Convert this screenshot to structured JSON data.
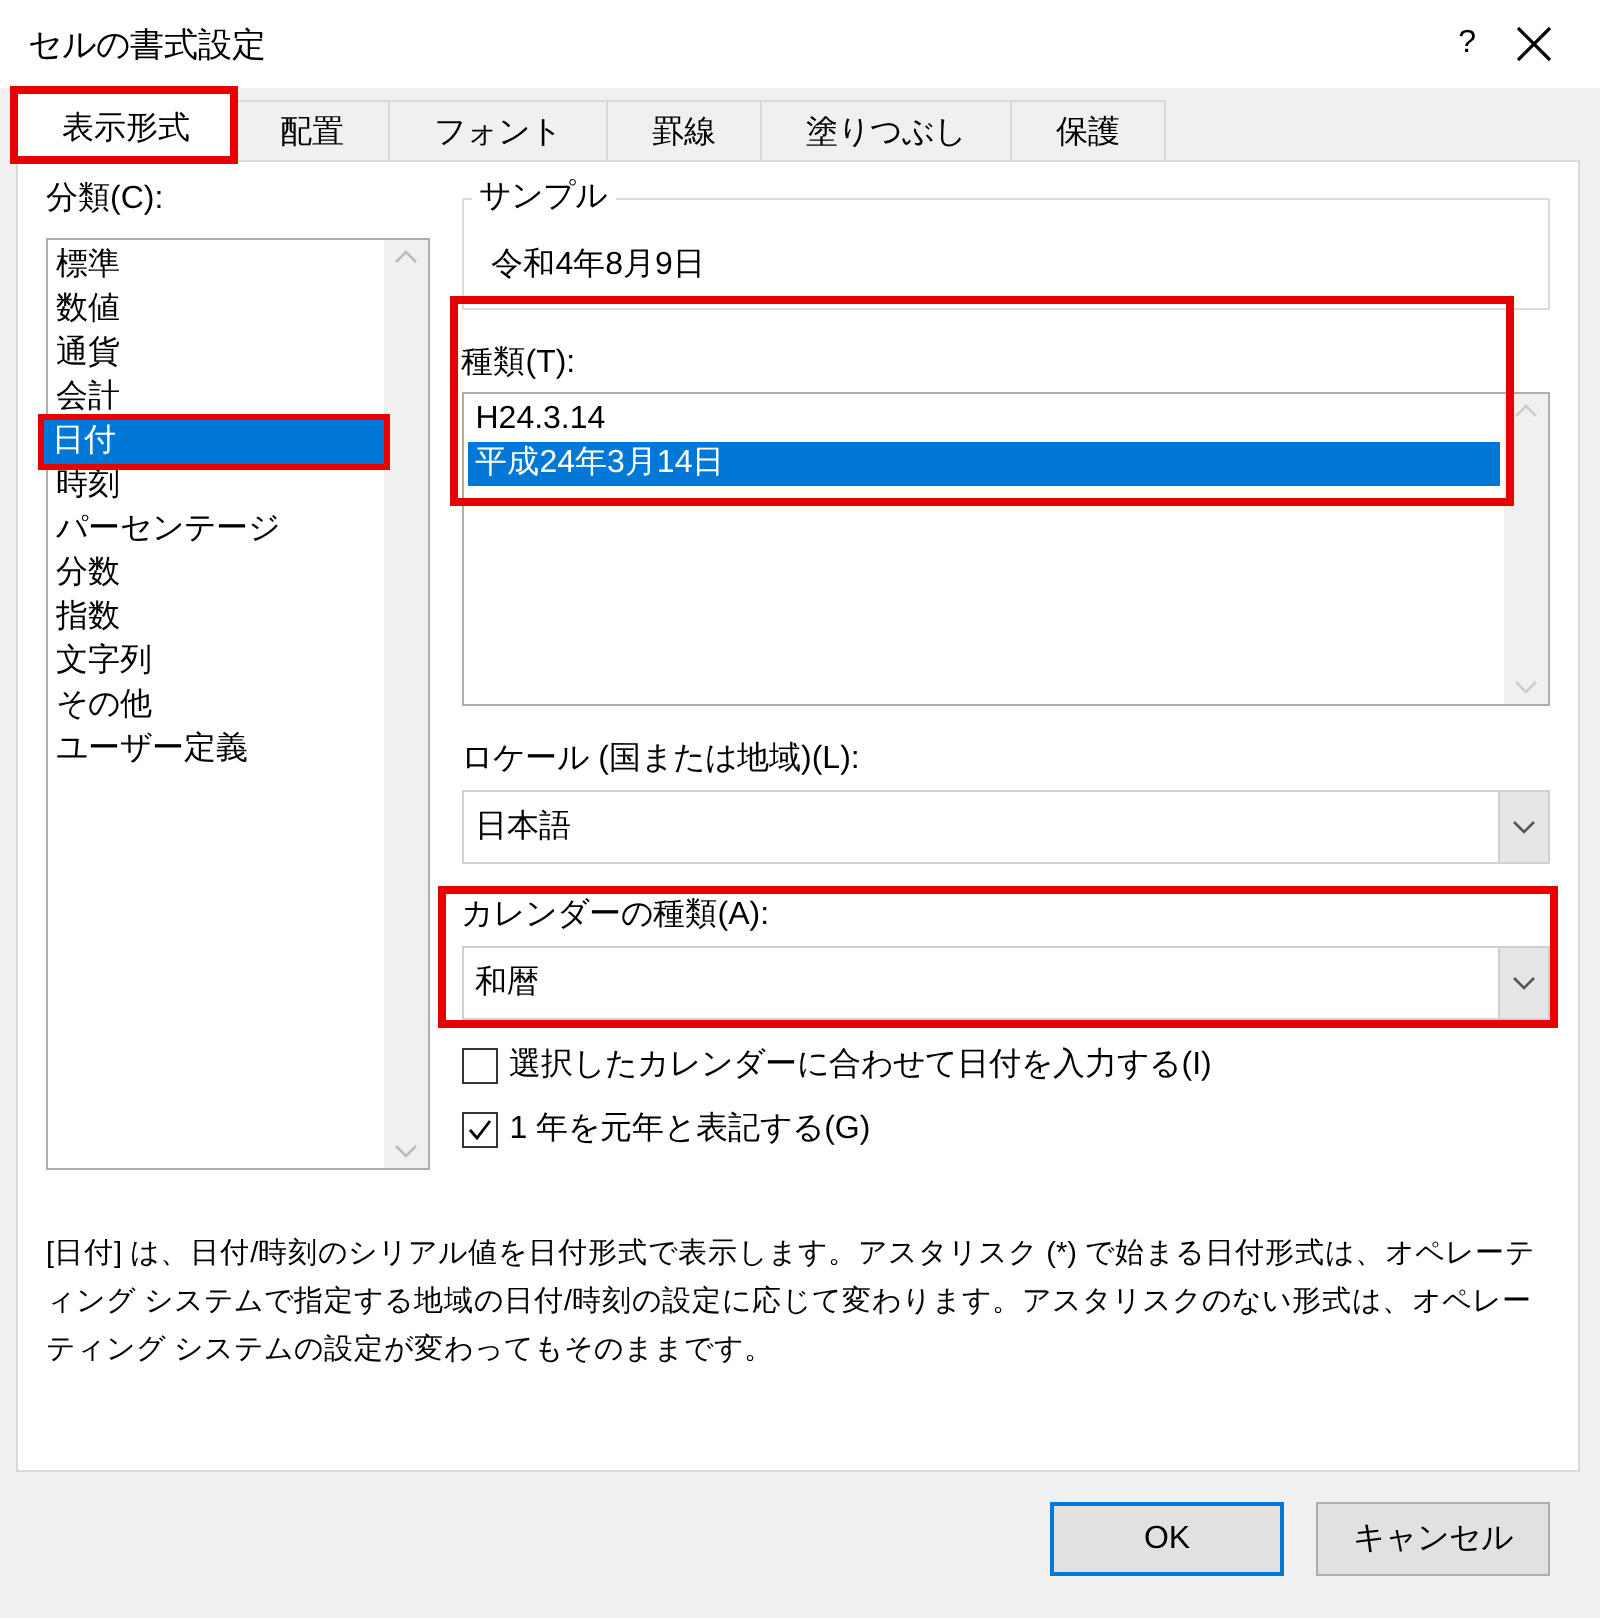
{
  "window": {
    "title": "セルの書式設定",
    "help": "?"
  },
  "tabs": [
    {
      "label": "表示形式",
      "selected": true,
      "highlighted": true
    },
    {
      "label": "配置",
      "selected": false,
      "highlighted": false
    },
    {
      "label": "フォント",
      "selected": false,
      "highlighted": false
    },
    {
      "label": "罫線",
      "selected": false,
      "highlighted": false
    },
    {
      "label": "塗りつぶし",
      "selected": false,
      "highlighted": false
    },
    {
      "label": "保護",
      "selected": false,
      "highlighted": false
    }
  ],
  "category": {
    "label": "分類(C):",
    "items": [
      {
        "label": "標準",
        "selected": false,
        "highlighted": false
      },
      {
        "label": "数値",
        "selected": false,
        "highlighted": false
      },
      {
        "label": "通貨",
        "selected": false,
        "highlighted": false
      },
      {
        "label": "会計",
        "selected": false,
        "highlighted": false
      },
      {
        "label": "日付",
        "selected": true,
        "highlighted": true
      },
      {
        "label": "時刻",
        "selected": false,
        "highlighted": false
      },
      {
        "label": "パーセンテージ",
        "selected": false,
        "highlighted": false
      },
      {
        "label": "分数",
        "selected": false,
        "highlighted": false
      },
      {
        "label": "指数",
        "selected": false,
        "highlighted": false
      },
      {
        "label": "文字列",
        "selected": false,
        "highlighted": false
      },
      {
        "label": "その他",
        "selected": false,
        "highlighted": false
      },
      {
        "label": "ユーザー定義",
        "selected": false,
        "highlighted": false
      }
    ]
  },
  "sample": {
    "label": "サンプル",
    "value": "令和4年8月9日"
  },
  "type": {
    "label": "種類(T):",
    "highlighted": true,
    "items": [
      {
        "label": "H24.3.14",
        "selected": false
      },
      {
        "label": "平成24年3月14日",
        "selected": true
      }
    ]
  },
  "locale": {
    "label": "ロケール (国または地域)(L):",
    "value": "日本語"
  },
  "calendar": {
    "label": "カレンダーの種類(A):",
    "value": "和暦",
    "highlighted": true
  },
  "options": [
    {
      "label": "選択したカレンダーに合わせて日付を入力する(I)",
      "checked": false
    },
    {
      "label": "1 年を元年と表記する(G)",
      "checked": true
    }
  ],
  "description": "[日付] は、日付/時刻のシリアル値を日付形式で表示します。アスタリスク (*) で始まる日付形式は、オペレーティング システムで指定する地域の日付/時刻の設定に応じて変わります。アスタリスクのない形式は、オペレーティング システムの設定が変わってもそのままです。",
  "buttons": [
    {
      "label": "OK",
      "default": true
    },
    {
      "label": "キャンセル",
      "default": false
    }
  ]
}
